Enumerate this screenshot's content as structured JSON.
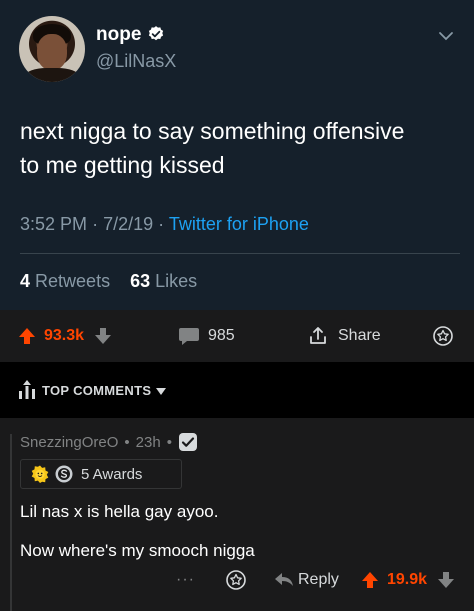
{
  "tweet": {
    "display_name": "nope",
    "handle": "@LilNasX",
    "text_line1": "next nigga to say something offensive",
    "text_line2": "to me getting kissed",
    "time": "3:52 PM",
    "date": "7/2/19",
    "separator": "·",
    "source": "Twitter for iPhone",
    "retweets_count": "4",
    "retweets_label": "Retweets",
    "likes_count": "63",
    "likes_label": "Likes",
    "icons": [
      "verified-badge-icon",
      "chevron-down-icon"
    ]
  },
  "post_actions": {
    "upvotes": "93.3k",
    "comments": "985",
    "share_label": "Share",
    "icons": [
      "upvote-arrow-icon",
      "downvote-arrow-icon",
      "comment-bubble-icon",
      "share-icon",
      "award-icon"
    ]
  },
  "comments_header": {
    "label": "TOP COMMENTS"
  },
  "comment": {
    "author": "SnezzingOreO",
    "age": "23h",
    "bullet": "•",
    "awards_label": "5 Awards",
    "body_line1": "Lil nas x is hella gay ayoo.",
    "body_line2": "Now where's my smooch nigga",
    "reply_label": "Reply",
    "score": "19.9k",
    "more_label": "···"
  },
  "colors": {
    "twitter_bg": "#15202b",
    "twitter_blue": "#1da1f2",
    "reddit_orange": "#ff4500",
    "reddit_panel": "#1a1a1b"
  }
}
